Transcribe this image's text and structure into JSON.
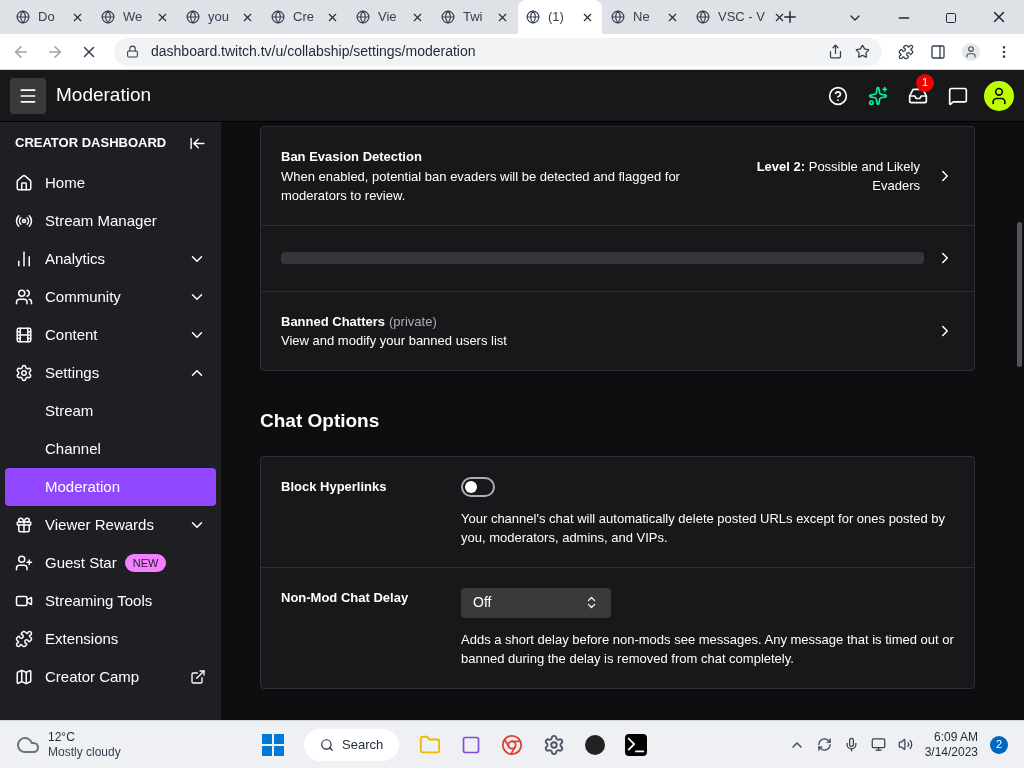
{
  "browser": {
    "tabs": [
      {
        "label": "Do",
        "selected": false
      },
      {
        "label": "We",
        "selected": false
      },
      {
        "label": "you",
        "selected": false
      },
      {
        "label": "Cre",
        "selected": false
      },
      {
        "label": "Vie",
        "selected": false
      },
      {
        "label": "Twi",
        "selected": false
      },
      {
        "label": "(1)",
        "selected": true
      },
      {
        "label": "Ne",
        "selected": false
      },
      {
        "label": "VSC - V",
        "selected": false
      }
    ],
    "address": "dashboard.twitch.tv/u/collabship/settings/moderation"
  },
  "app_bar": {
    "title": "Moderation",
    "notification_count": "1"
  },
  "sidebar": {
    "heading": "CREATOR DASHBOARD",
    "items": [
      {
        "label": "Home",
        "selected": false
      },
      {
        "label": "Stream Manager",
        "selected": false
      },
      {
        "label": "Analytics",
        "selected": false,
        "expanded": false
      },
      {
        "label": "Community",
        "selected": false,
        "expanded": false
      },
      {
        "label": "Content",
        "selected": false,
        "expanded": false
      },
      {
        "label": "Settings",
        "selected": false,
        "expanded": true,
        "children": [
          {
            "label": "Stream",
            "selected": false
          },
          {
            "label": "Channel",
            "selected": false
          },
          {
            "label": "Moderation",
            "selected": true
          }
        ]
      },
      {
        "label": "Viewer Rewards",
        "selected": false,
        "expanded": false
      },
      {
        "label": "Guest Star",
        "selected": false,
        "badge": "NEW"
      },
      {
        "label": "Streaming Tools",
        "selected": false
      },
      {
        "label": "Extensions",
        "selected": false
      },
      {
        "label": "Creator Camp",
        "selected": false,
        "external": true
      }
    ]
  },
  "moderation_card": {
    "rows": [
      {
        "kind": "setting",
        "title": "Ban Evasion Detection",
        "description": "When enabled, potential ban evaders will be detected and flagged for moderators to review.",
        "value": "**Level 2:** Possible and Likely Evaders"
      },
      {
        "kind": "loading"
      },
      {
        "kind": "setting",
        "title": "Banned Chatters",
        "note": "(private)",
        "description": "View and modify your banned users list"
      }
    ]
  },
  "chat_options": {
    "heading": "Chat Options",
    "rows": [
      {
        "kind": "toggle",
        "title": "Block Hyperlinks",
        "on": false,
        "description": "Your channel's chat will automatically delete posted URLs except for ones posted by you, moderators, admins, and VIPs."
      },
      {
        "kind": "select",
        "title": "Non-Mod Chat Delay",
        "value": "Off",
        "description": "Adds a short delay before non-mods see messages. Any message that is timed out or banned during the delay is removed from chat completely."
      }
    ]
  },
  "taskbar": {
    "temperature": "12°C",
    "weather": "Mostly cloudy",
    "search": "Search",
    "time": "6:09 AM",
    "date": "3/14/2023",
    "notification_count": "2"
  }
}
